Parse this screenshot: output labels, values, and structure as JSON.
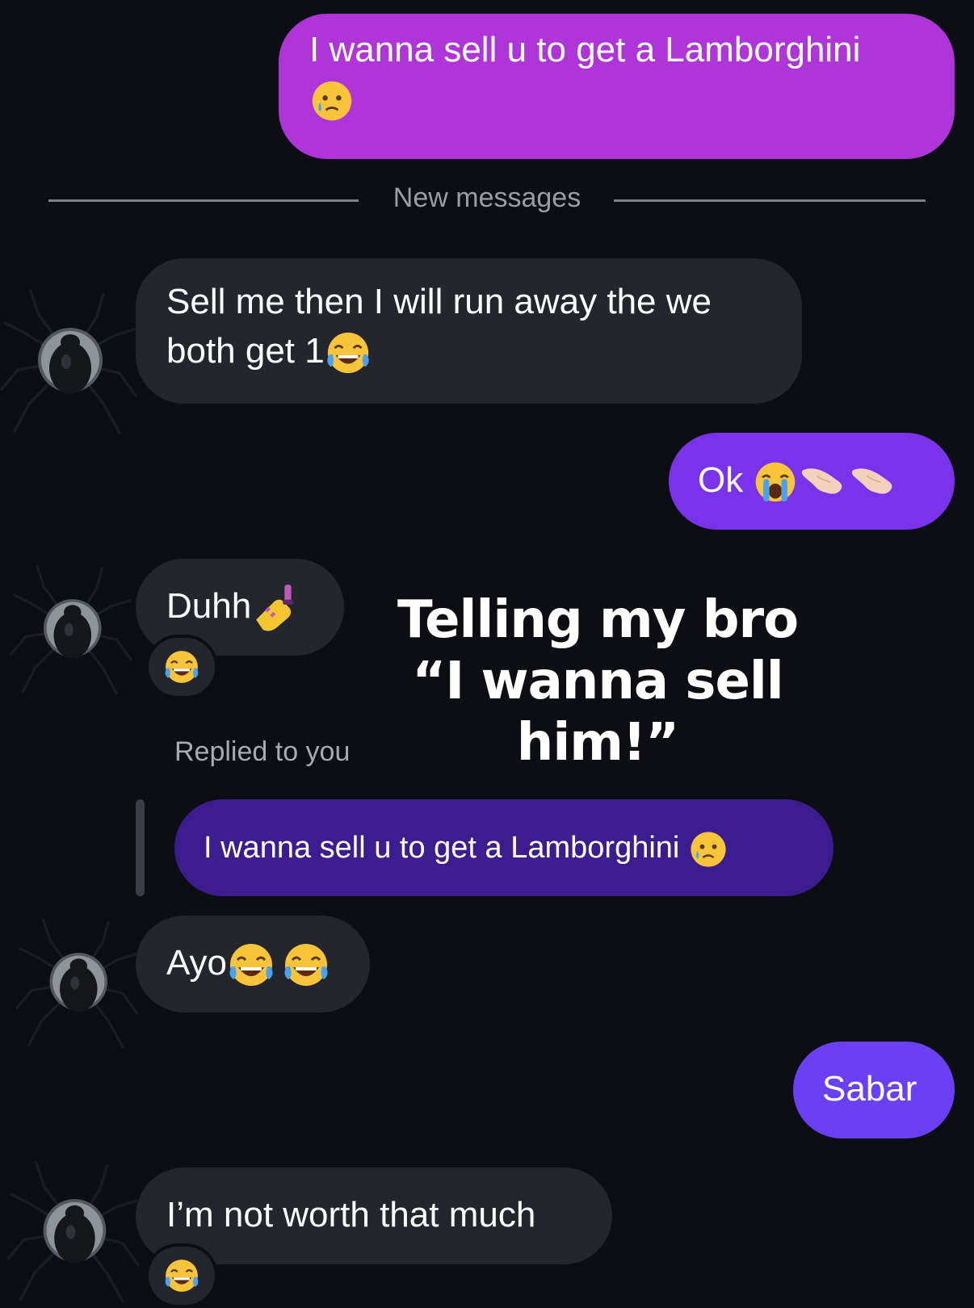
{
  "messages": [
    {
      "id": "m1",
      "from": "me",
      "text": "I wanna sell u to get a Lamborghini"
    },
    {
      "id": "m2",
      "from": "them",
      "text_line1": "Sell me then I will run away the we",
      "text_line2": "both get 1"
    },
    {
      "id": "m3",
      "from": "me",
      "text": "Ok"
    },
    {
      "id": "m4",
      "from": "them",
      "text": "Duhh"
    },
    {
      "id": "m5",
      "from": "them",
      "text": "Ayo"
    },
    {
      "id": "m6",
      "from": "me",
      "text": "Sabar"
    },
    {
      "id": "m7",
      "from": "them",
      "text": "I’m not worth that much"
    }
  ],
  "divider": {
    "label": "New messages"
  },
  "reply": {
    "label": "Replied to you",
    "quoted_text": "I wanna sell u to get a Lamborghini"
  },
  "overlay": {
    "line1": "Telling my bro",
    "line2": "“I wanna sell him!”"
  },
  "colors": {
    "background": "#0c0e14",
    "received_bubble": "#23262d",
    "sent_m1": "#b035d8",
    "sent_m3": "#7a33ea",
    "sent_m6": "#6a40f5",
    "quoted_bubble": "#3b1d8f"
  },
  "icons": {
    "tear-smile": "smiling face with tear emoji",
    "laugh": "face with tears of joy emoji",
    "sob": "loudly crying face emoji",
    "point": "backhand pointing hand emoji",
    "nails": "nail polish emoji",
    "avatar": "black spider image"
  }
}
